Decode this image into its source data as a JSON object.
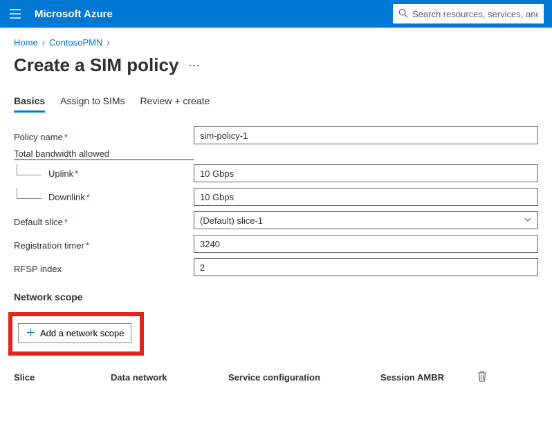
{
  "topbar": {
    "brand": "Microsoft Azure",
    "search_placeholder": "Search resources, services, and docs"
  },
  "breadcrumb": {
    "items": [
      "Home",
      "ContosoPMN"
    ]
  },
  "page": {
    "title": "Create a SIM policy"
  },
  "tabs": {
    "items": [
      {
        "label": "Basics",
        "active": true
      },
      {
        "label": "Assign to SIMs",
        "active": false
      },
      {
        "label": "Review + create",
        "active": false
      }
    ]
  },
  "form": {
    "policy_name_label": "Policy name",
    "policy_name_value": "sim-policy-1",
    "bandwidth_group_label": "Total bandwidth allowed",
    "uplink_label": "Uplink",
    "uplink_value": "10 Gbps",
    "downlink_label": "Downlink",
    "downlink_value": "10 Gbps",
    "default_slice_label": "Default slice",
    "default_slice_value": "(Default) slice-1",
    "reg_timer_label": "Registration timer",
    "reg_timer_value": "3240",
    "rfsp_label": "RFSP index",
    "rfsp_value": "2"
  },
  "network_scope": {
    "title": "Network scope",
    "add_label": "Add a network scope",
    "columns": {
      "slice": "Slice",
      "data_network": "Data network",
      "service_config": "Service configuration",
      "session_ambr": "Session AMBR"
    }
  }
}
